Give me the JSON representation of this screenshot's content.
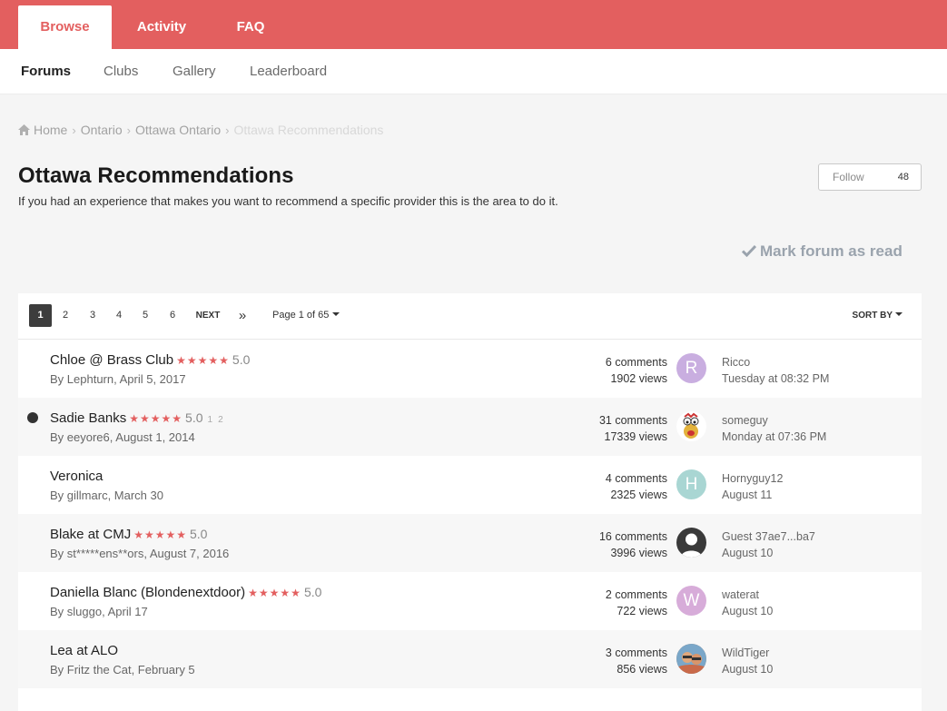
{
  "nav": {
    "tabs": [
      {
        "label": "Browse"
      },
      {
        "label": "Activity"
      },
      {
        "label": "FAQ"
      }
    ],
    "subtabs": [
      {
        "label": "Forums"
      },
      {
        "label": "Clubs"
      },
      {
        "label": "Gallery"
      },
      {
        "label": "Leaderboard"
      }
    ]
  },
  "breadcrumb": [
    "Home",
    "Ontario",
    "Ottawa Ontario",
    "Ottawa Recommendations"
  ],
  "forum": {
    "title": "Ottawa Recommendations",
    "description": "If you had an experience that makes you want to recommend a specific provider this is the area to do it.",
    "follow_label": "Follow",
    "follow_count": "48",
    "mark_read": "Mark forum as read"
  },
  "pager": {
    "pages": [
      "1",
      "2",
      "3",
      "4",
      "5",
      "6"
    ],
    "next": "NEXT",
    "last": "»",
    "page_of": "Page 1 of 65",
    "sort_by": "SORT BY"
  },
  "topics": [
    {
      "title": "Chloe @ Brass Club",
      "stars": "★★★★★",
      "rating": "5.0",
      "byline": "By Lephturn, April 5, 2017",
      "comments": "6 comments",
      "views": "1902 views",
      "avatar_letter": "R",
      "avatar_color": "#c9aee0",
      "last_user": "Ricco",
      "last_time": "Tuesday at 08:32 PM"
    },
    {
      "title": "Sadie Banks",
      "stars": "★★★★★",
      "rating": "5.0",
      "mini_pages": [
        "1",
        "2"
      ],
      "byline": "By eeyore6, August 1, 2014",
      "comments": "31 comments",
      "views": "17339 views",
      "avatar_letter": "",
      "avatar_color": "#ffffff",
      "last_user": "someguy",
      "last_time": "Monday at 07:36 PM"
    },
    {
      "title": "Veronica",
      "byline": "By gillmarc, March 30",
      "comments": "4 comments",
      "views": "2325 views",
      "avatar_letter": "H",
      "avatar_color": "#a9d6d3",
      "last_user": "Hornyguy12",
      "last_time": "August 11"
    },
    {
      "title": "Blake at CMJ",
      "stars": "★★★★★",
      "rating": "5.0",
      "byline": "By st*****ens**ors, August 7, 2016",
      "comments": "16 comments",
      "views": "3996 views",
      "avatar_letter": "",
      "avatar_color": "#3a3a3a",
      "last_user": "Guest 37ae7...ba7",
      "last_time": "August 10"
    },
    {
      "title": "Daniella Blanc (Blondenextdoor)",
      "stars": "★★★★★",
      "rating": "5.0",
      "byline": "By sluggo, April 17",
      "comments": "2 comments",
      "views": "722 views",
      "avatar_letter": "W",
      "avatar_color": "#d7acd9",
      "last_user": "waterat",
      "last_time": "August 10"
    },
    {
      "title": "Lea at ALO",
      "byline": "By Fritz the Cat, February 5",
      "comments": "3 comments",
      "views": "856 views",
      "avatar_letter": "",
      "avatar_color": "#c98a5a",
      "last_user": "WildTiger",
      "last_time": "August 10"
    }
  ]
}
